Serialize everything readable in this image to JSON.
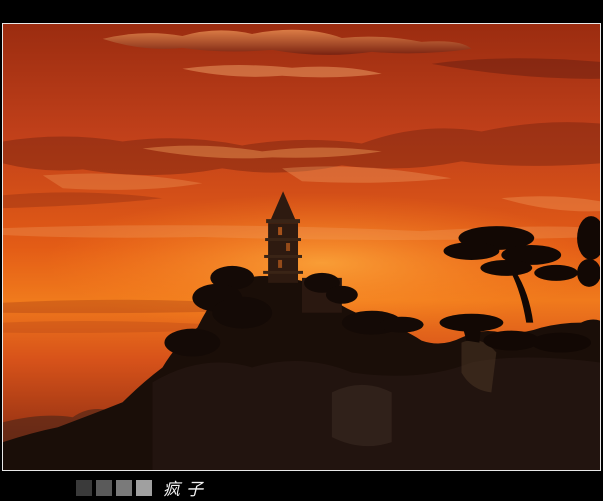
{
  "footer": {
    "signature": "疯子",
    "swatches": [
      "#3a3a3a",
      "#5a5a5a",
      "#7a7a7a",
      "#a0a0a0"
    ]
  }
}
